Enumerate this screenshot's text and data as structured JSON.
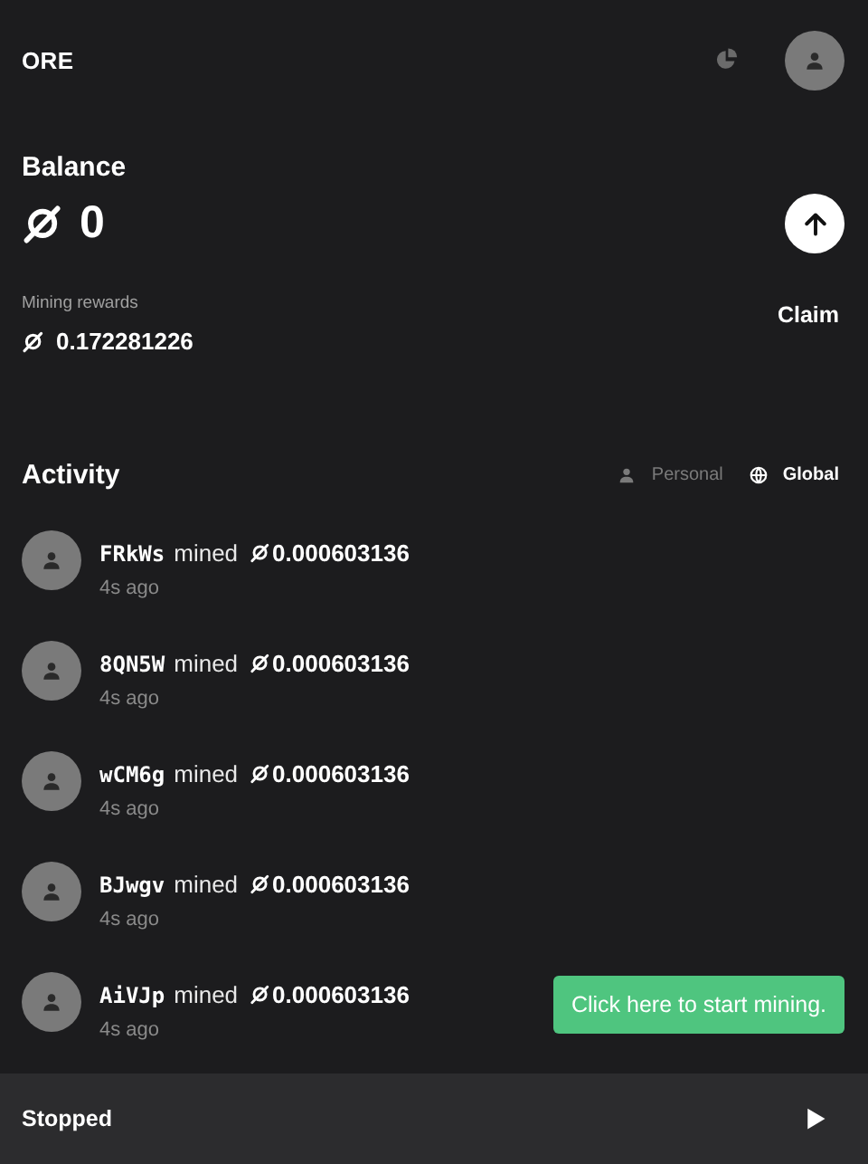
{
  "header": {
    "logo": "ORE"
  },
  "balance": {
    "title": "Balance",
    "amount": "0"
  },
  "rewards": {
    "label": "Mining rewards",
    "amount": "0.172281226",
    "action": "Claim"
  },
  "activity": {
    "title": "Activity",
    "tabs": [
      {
        "label": "Personal",
        "kind": "person",
        "selected": false
      },
      {
        "label": "Global",
        "kind": "globe",
        "selected": true
      }
    ],
    "items": [
      {
        "user": "FRkWs",
        "verb": "mined",
        "amount": "0.000603136",
        "time": "4s ago"
      },
      {
        "user": "8QN5W",
        "verb": "mined",
        "amount": "0.000603136",
        "time": "4s ago"
      },
      {
        "user": "wCM6g",
        "verb": "mined",
        "amount": "0.000603136",
        "time": "4s ago"
      },
      {
        "user": "BJwgv",
        "verb": "mined",
        "amount": "0.000603136",
        "time": "4s ago"
      },
      {
        "user": "AiVJp",
        "verb": "mined",
        "amount": "0.000603136",
        "time": "4s ago"
      }
    ]
  },
  "toast": "Click here to start mining.",
  "status_bar": {
    "status": "Stopped"
  }
}
